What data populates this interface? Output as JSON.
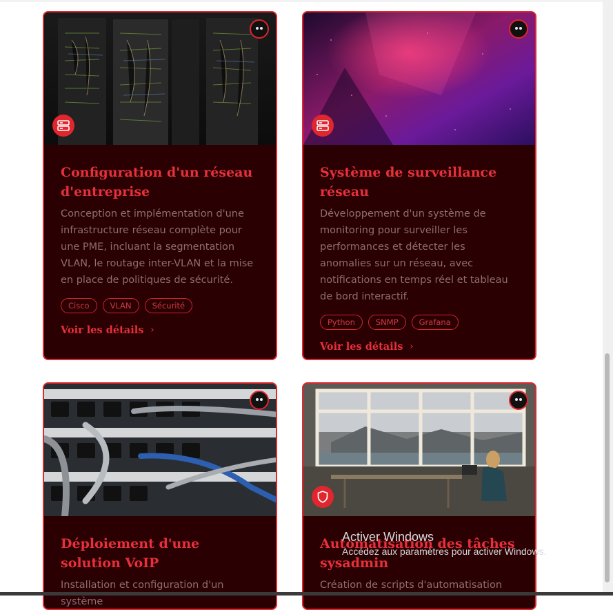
{
  "projects": [
    {
      "title": "Configuration d'un réseau d'entreprise",
      "description": "Conception et implémentation d'une infrastructure réseau complète pour une PME, incluant la segmentation VLAN, le routage inter-VLAN et la mise en place de politiques de sécurité.",
      "tags": [
        "Cisco",
        "VLAN",
        "Sécurité"
      ],
      "details_label": "Voir les détails",
      "category_icon": "server-icon"
    },
    {
      "title": "Système de surveillance réseau",
      "description": "Développement d'un système de monitoring pour surveiller les performances et détecter les anomalies sur un réseau, avec notifications en temps réel et tableau de bord interactif.",
      "tags": [
        "Python",
        "SNMP",
        "Grafana"
      ],
      "details_label": "Voir les détails",
      "category_icon": "server-icon"
    },
    {
      "title": "Déploiement d'une solution VoIP",
      "description": "Installation et configuration d'un système",
      "category_icon": "none"
    },
    {
      "title": "Automatisation des tâches sysadmin",
      "description": "Création de scripts d'automatisation",
      "category_icon": "shield-icon"
    }
  ],
  "watermark": {
    "line1": "Activer Windows",
    "line2": "Accédez aux paramètres pour activer Windows."
  },
  "colors": {
    "accent": "#e0262e",
    "card_bg": "#2a0003",
    "text_muted": "#8d6f70"
  }
}
